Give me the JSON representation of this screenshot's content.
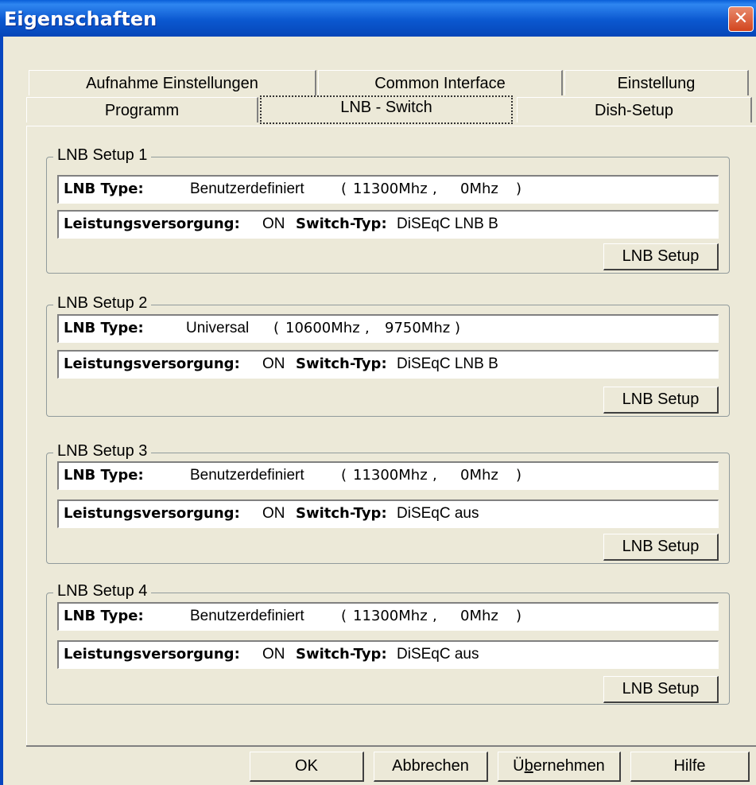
{
  "window": {
    "title": "Eigenschaften",
    "close_glyph": "✕"
  },
  "tabs": {
    "row1": [
      "Aufnahme Einstellungen",
      "Common Interface",
      "Einstellung"
    ],
    "row2": [
      "Programm",
      "LNB - Switch",
      "Dish-Setup"
    ],
    "active": "LNB - Switch"
  },
  "groups": [
    {
      "legend": "LNB Setup 1",
      "lnb_type_label": "LNB Type:",
      "lnb_type": "Benutzerdefiniert",
      "freq1": "11300Mhz",
      "freq2": "0Mhz",
      "power_label": "Leistungsversorgung:",
      "power_value": "ON",
      "switch_label": "Switch-Typ:",
      "switch_value": "DiSEqC LNB B",
      "button": "LNB Setup"
    },
    {
      "legend": "LNB Setup 2",
      "lnb_type_label": "LNB Type:",
      "lnb_type": "Universal",
      "freq1": "10600Mhz",
      "freq2": "9750Mhz",
      "power_label": "Leistungsversorgung:",
      "power_value": "ON",
      "switch_label": "Switch-Typ:",
      "switch_value": "DiSEqC LNB B",
      "button": "LNB Setup"
    },
    {
      "legend": "LNB Setup 3",
      "lnb_type_label": "LNB Type:",
      "lnb_type": "Benutzerdefiniert",
      "freq1": "11300Mhz",
      "freq2": "0Mhz",
      "power_label": "Leistungsversorgung:",
      "power_value": "ON",
      "switch_label": "Switch-Typ:",
      "switch_value": "DiSEqC aus",
      "button": "LNB Setup"
    },
    {
      "legend": "LNB Setup 4",
      "lnb_type_label": "LNB Type:",
      "lnb_type": "Benutzerdefiniert",
      "freq1": "11300Mhz",
      "freq2": "0Mhz",
      "power_label": "Leistungsversorgung:",
      "power_value": "ON",
      "switch_label": "Switch-Typ:",
      "switch_value": "DiSEqC aus",
      "button": "LNB Setup"
    }
  ],
  "footer": {
    "ok": "OK",
    "cancel": "Abbrechen",
    "apply_pre": "Ü",
    "apply_mnemonic": "b",
    "apply_post": "ernehmen",
    "help": "Hilfe"
  }
}
